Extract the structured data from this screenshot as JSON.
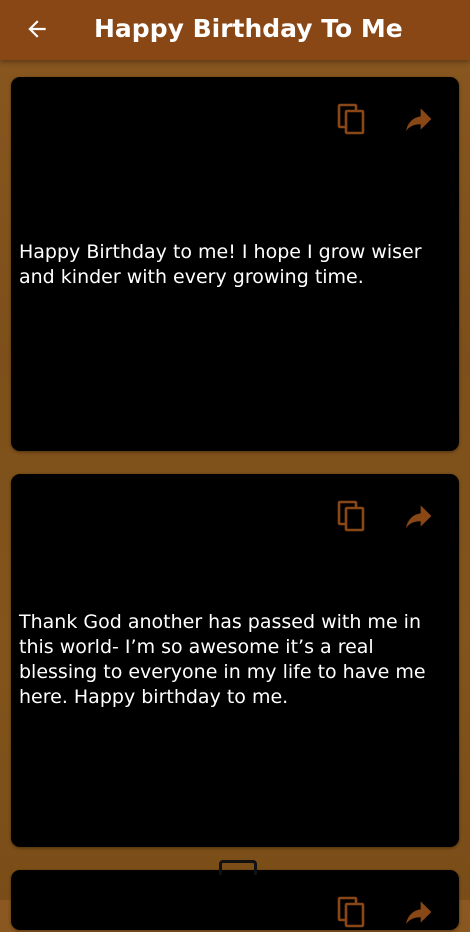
{
  "app": {
    "title": "Happy Birthday To Me"
  },
  "icons": {
    "back": "arrow-left-icon",
    "copy": "content-copy-icon",
    "share": "share-forward-icon"
  },
  "colors": {
    "appbar": "#8a4716",
    "background": "#7d4f1a",
    "card": "#000000",
    "accent_icon": "#8a4716",
    "text": "#ffffff"
  },
  "quotes": [
    {
      "text": "Happy Birthday to me! I hope I grow wiser and kinder with every growing time."
    },
    {
      "text": "Thank God another has passed with me in this world- I’m so awesome it’s a real blessing to everyone in my life to have me here. Happy birthday to me."
    }
  ]
}
